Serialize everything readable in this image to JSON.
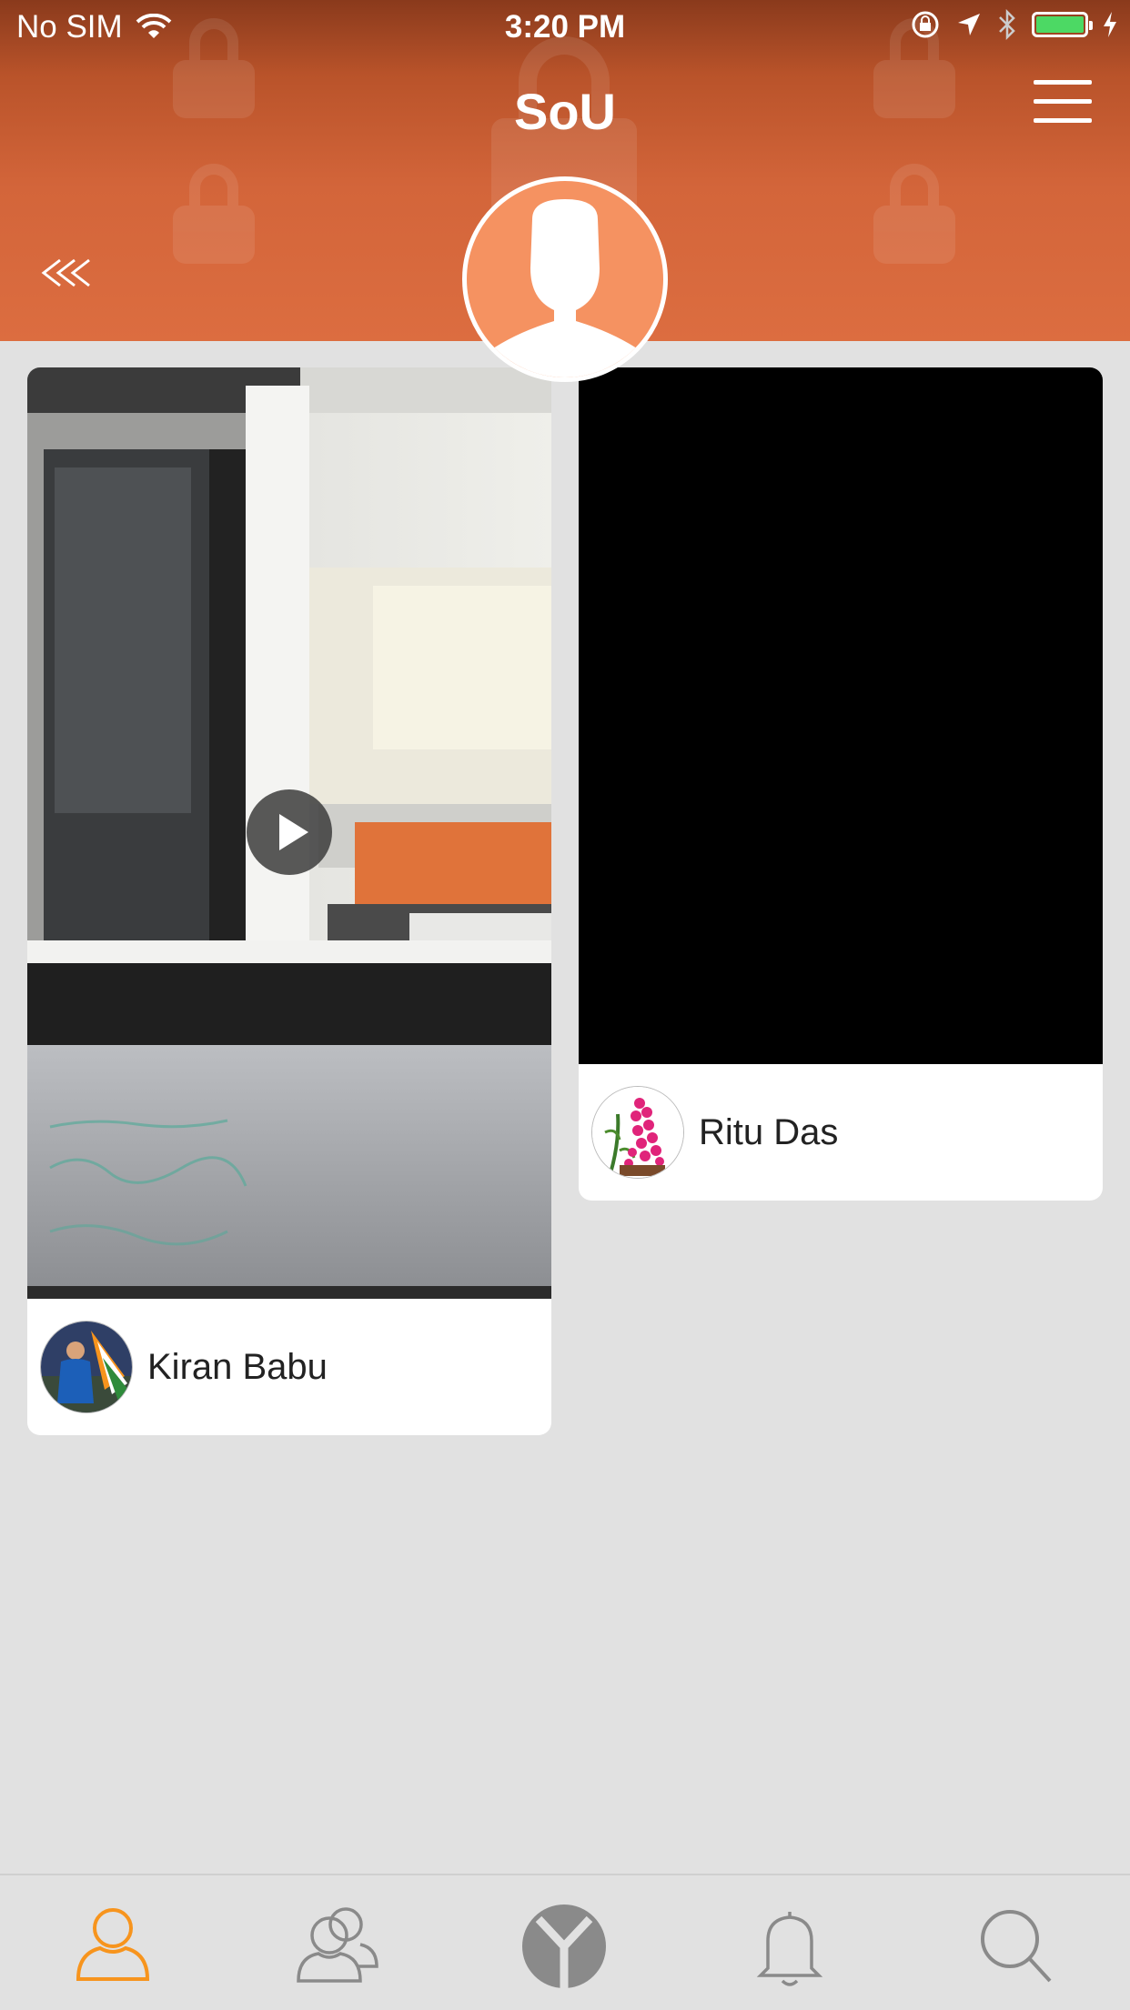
{
  "status_bar": {
    "carrier": "No SIM",
    "time": "3:20 PM",
    "battery_color": "#4cd964"
  },
  "header": {
    "title": "SoU",
    "background_color": "#dc6d40",
    "back_icon": "double-chevron-left-icon",
    "menu_icon": "hamburger-menu-icon"
  },
  "profile": {
    "avatar_icon": "default-person-silhouette",
    "avatar_color": "#f59261"
  },
  "posts": [
    {
      "type": "video",
      "user_name": "Kiran Babu",
      "avatar_icon": "cricket-player-photo"
    },
    {
      "type": "image",
      "user_name": "Ritu Das",
      "avatar_icon": "rose-bouquet-photo"
    }
  ],
  "tab_bar": {
    "tabs": [
      {
        "icon": "profile-icon",
        "active": true
      },
      {
        "icon": "friends-icon",
        "active": false
      },
      {
        "icon": "app-logo-icon",
        "active": false
      },
      {
        "icon": "notifications-bell-icon",
        "active": false
      },
      {
        "icon": "search-icon",
        "active": false
      }
    ],
    "active_color": "#f7941d",
    "inactive_color": "#8a8a8a"
  }
}
